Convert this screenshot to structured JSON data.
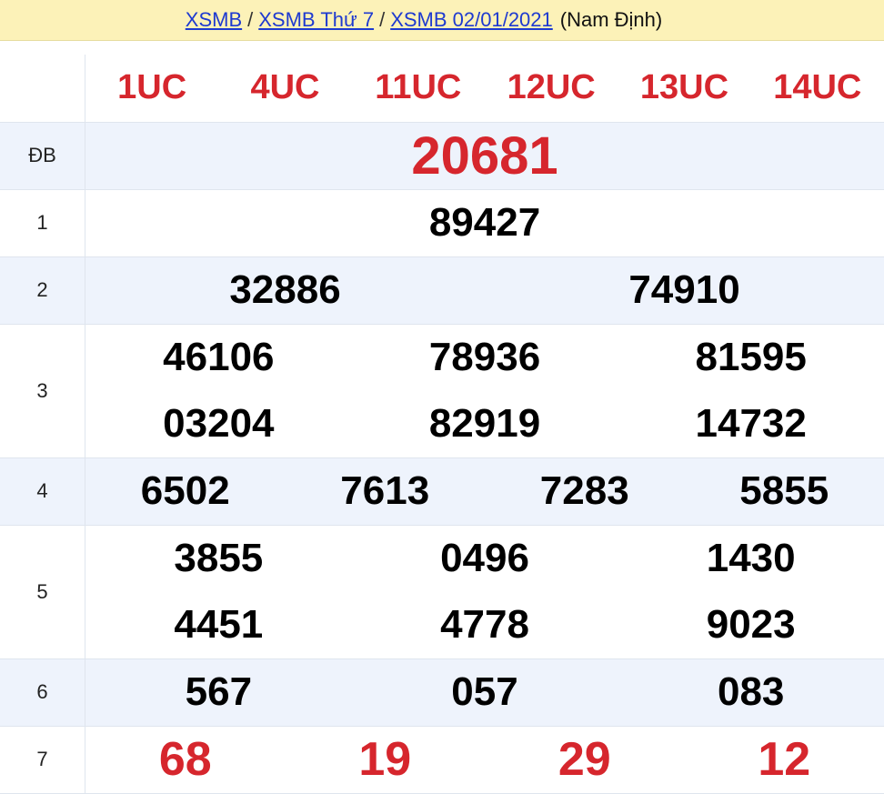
{
  "breadcrumb": {
    "link1": "XSMB",
    "link2": "XSMB Thứ 7",
    "link3": "XSMB 02/01/2021",
    "separator": "/",
    "province": "(Nam Định)"
  },
  "codes": [
    "1UC",
    "4UC",
    "11UC",
    "12UC",
    "13UC",
    "14UC"
  ],
  "prizes": {
    "db": {
      "label": "ĐB",
      "numbers": [
        "20681"
      ]
    },
    "p1": {
      "label": "1",
      "numbers": [
        "89427"
      ]
    },
    "p2": {
      "label": "2",
      "numbers": [
        "32886",
        "74910"
      ]
    },
    "p3": {
      "label": "3",
      "numbers": [
        "46106",
        "78936",
        "81595",
        "03204",
        "82919",
        "14732"
      ]
    },
    "p4": {
      "label": "4",
      "numbers": [
        "6502",
        "7613",
        "7283",
        "5855"
      ]
    },
    "p5": {
      "label": "5",
      "numbers": [
        "3855",
        "0496",
        "1430",
        "4451",
        "4778",
        "9023"
      ]
    },
    "p6": {
      "label": "6",
      "numbers": [
        "567",
        "057",
        "083"
      ]
    },
    "p7": {
      "label": "7",
      "numbers": [
        "68",
        "19",
        "29",
        "12"
      ]
    }
  },
  "colors": {
    "accent_red": "#d6262d",
    "header_bg": "#fcf2b8",
    "link": "#1e3ad0",
    "alt_row": "#eef3fc"
  }
}
